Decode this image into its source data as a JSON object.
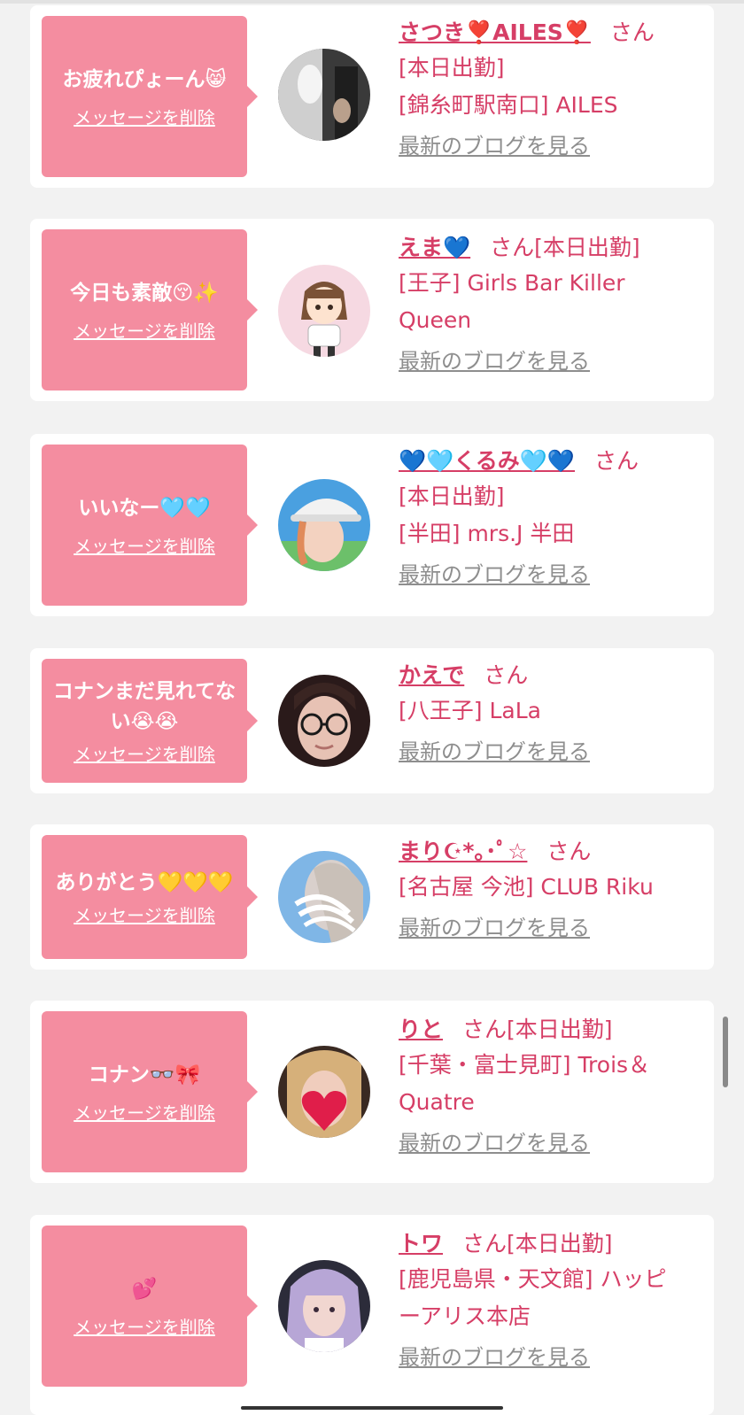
{
  "delete_label": "メッセージを削除",
  "blog_label": "最新のブログを見る",
  "honorific": "さん",
  "colors": {
    "bubble": "#f48da0",
    "name": "#d63e66",
    "link_gray": "#8e8e8e",
    "background": "#f2f2f2"
  },
  "cards": [
    {
      "message": "お疲れぴょーん😸",
      "name": "さつき❣️AILES❣️",
      "san_inline": false,
      "details": [
        "[本日出勤]",
        "[錦糸町駅南口] AILES"
      ],
      "avatar_icon": "monochrome-photo-avatar"
    },
    {
      "message": "今日も素敵😚✨",
      "name": "えま💙",
      "san_inline": true,
      "status": "[本日出勤]",
      "details": [
        "[王子] Girls Bar Killer",
        "Queen"
      ],
      "avatar_icon": "illustrated-girl-avatar"
    },
    {
      "message": "いいなー🩵🩵",
      "name": "💙🩵くるみ🩵💙",
      "san_inline": false,
      "details": [
        "[本日出勤]",
        "[半田] mrs.J 半田"
      ],
      "avatar_icon": "cap-photo-avatar"
    },
    {
      "message": "コナンまだ見れてない😭😭",
      "name": "かえで",
      "san_inline": false,
      "details": [
        "[八王子] LaLa"
      ],
      "avatar_icon": "glasses-photo-avatar"
    },
    {
      "message": "ありがとう💛💛💛",
      "name": "まり☪︎*｡･ﾟ☆",
      "san_inline": false,
      "details": [
        "[名古屋 今池] CLUB Riku"
      ],
      "avatar_icon": "blurred-photo-avatar"
    },
    {
      "message": "コナン👓🎀",
      "name": "りと",
      "san_inline": true,
      "status": "[本日出勤]",
      "details": [
        "[千葉・富士見町] Trois＆",
        "Quatre"
      ],
      "avatar_icon": "heart-cover-photo-avatar"
    },
    {
      "message": "💕",
      "name": "トワ",
      "san_inline": true,
      "status": "[本日出勤]",
      "details": [
        "[鹿児島県・天文館] ハッピ",
        "ーアリス本店"
      ],
      "avatar_icon": "lavender-hair-photo-avatar"
    }
  ]
}
